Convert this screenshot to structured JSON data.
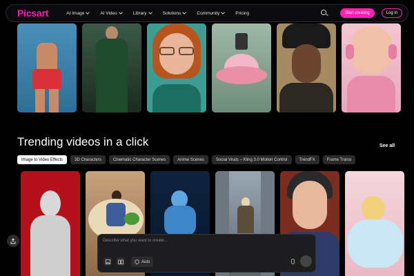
{
  "brand": {
    "logo": "Picsart",
    "accent": "#ff1fb4"
  },
  "nav": {
    "items": [
      {
        "label": "AI Image",
        "has_menu": true
      },
      {
        "label": "AI Video",
        "has_menu": true
      },
      {
        "label": "Library",
        "has_menu": true
      },
      {
        "label": "Solutions",
        "has_menu": true
      },
      {
        "label": "Community",
        "has_menu": true
      },
      {
        "label": "Pricing",
        "has_menu": false
      }
    ],
    "start_label": "Start creating",
    "login_label": "Log in"
  },
  "trending": {
    "title": "Trending videos in a click",
    "see_all": "See all",
    "chips": [
      "Image to Video Effects",
      "3D Characters",
      "Cinematic Character Scenes",
      "Anime Scenes",
      "Social Virals – Kling 3.0 Motion Control",
      "TrendFX",
      "Frame Transi"
    ],
    "active_chip_index": 0
  },
  "prompt": {
    "placeholder": "Describe what you want to create...",
    "auto_label": "Auto"
  },
  "icons": {
    "search": "search-icon",
    "share": "share-icon",
    "image_upload": "image-icon",
    "storyboard": "book-icon",
    "auto": "auto-icon",
    "mic": "mic-icon",
    "send": "send-icon"
  }
}
